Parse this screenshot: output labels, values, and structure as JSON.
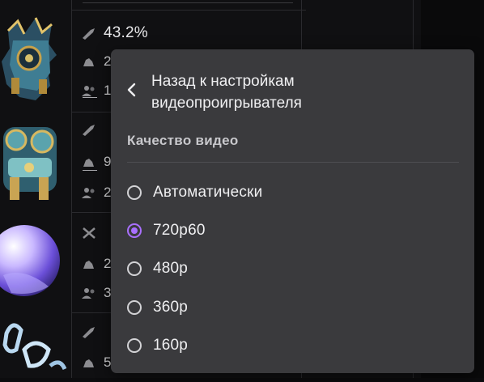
{
  "background": {
    "rows": [
      {
        "item_icon": "mechanical-relic-icon",
        "pick_rate": "43.2%",
        "stat2": "2",
        "stat3": "1"
      },
      {
        "item_icon": "mechanical-relic-icon",
        "pick_rate": "",
        "stat2": "9",
        "stat3": "2"
      },
      {
        "item_icon": "crystal-orb-icon",
        "pick_rate": "",
        "stat2": "2",
        "stat3": "3"
      },
      {
        "item_icon": "ice-chain-icon",
        "pick_rate": "",
        "stat2": "5",
        "stat3": ""
      }
    ]
  },
  "menu": {
    "back_label": "Назад к настройкам видеопроигрывателя",
    "section_title": "Качество видео",
    "options": [
      {
        "label": "Автоматически",
        "selected": false
      },
      {
        "label": "720p60",
        "selected": true
      },
      {
        "label": "480p",
        "selected": false
      },
      {
        "label": "360p",
        "selected": false
      },
      {
        "label": "160p",
        "selected": false
      }
    ],
    "accent_color": "#a970ff"
  }
}
